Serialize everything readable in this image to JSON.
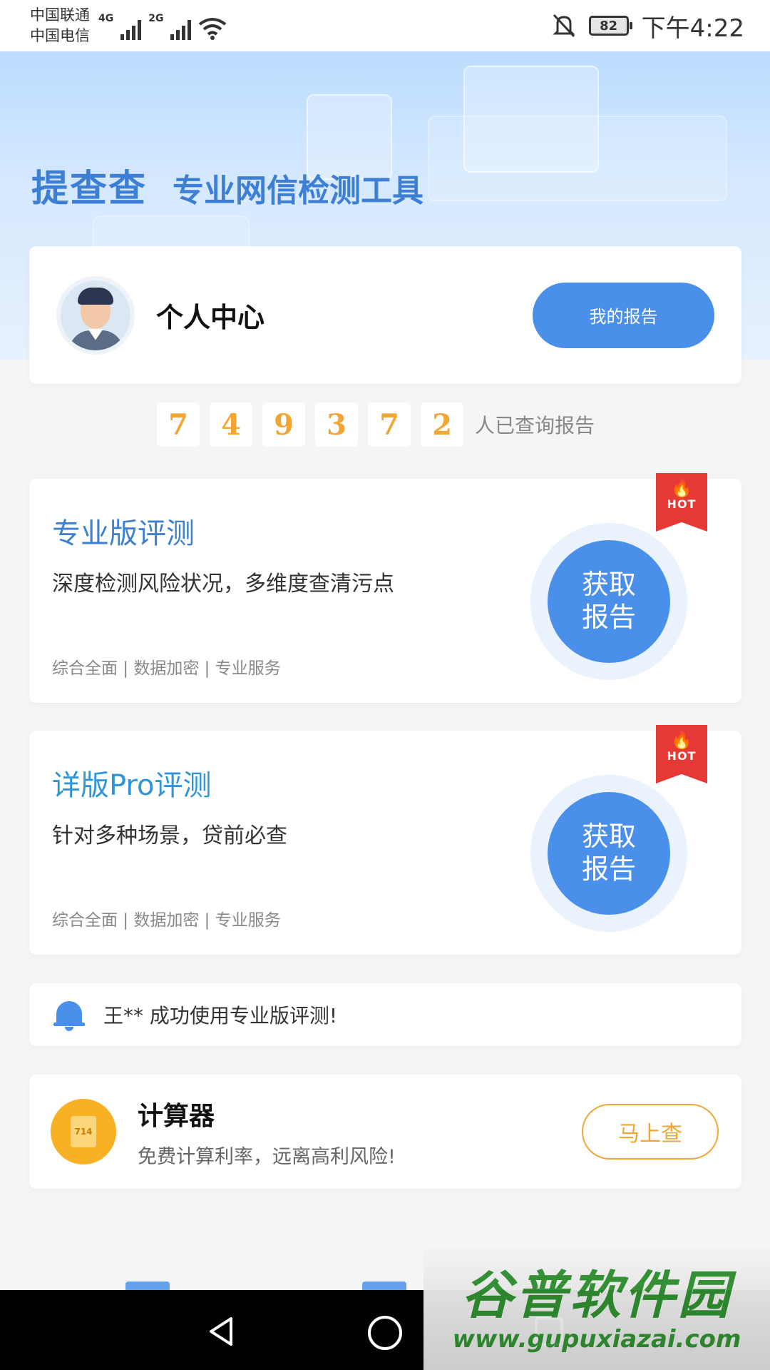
{
  "status_bar": {
    "carrier_1": "中国联通",
    "carrier_2": "中国电信",
    "net_1": "4G",
    "net_2": "2G",
    "battery": "82",
    "time": "下午4:22"
  },
  "banner": {
    "brand": "提查查",
    "slogan": "专业网信检测工具"
  },
  "profile": {
    "title": "个人中心",
    "report_button": "我的报告"
  },
  "counter": {
    "digits": [
      "7",
      "4",
      "9",
      "3",
      "7",
      "2"
    ],
    "label": "人已查询报告"
  },
  "products": [
    {
      "title": "专业版评测",
      "desc": "深度检测风险状况，多维度查清污点",
      "tags": "综合全面 | 数据加密 | 专业服务",
      "button": "获取报告",
      "badge": "HOT"
    },
    {
      "title": "详版Pro评测",
      "desc": "针对多种场景，贷前必查",
      "tags": "综合全面 | 数据加密 | 专业服务",
      "button": "获取报告",
      "badge": "HOT"
    }
  ],
  "notice": {
    "text": "王** 成功使用专业版评测!"
  },
  "calculator": {
    "icon_text": "714",
    "title": "计算器",
    "subtitle": "免费计算利率，远离高利风险!",
    "button": "马上查"
  },
  "watermark": {
    "title": "谷普软件园",
    "url": "www.gupuxiazai.com"
  },
  "colors": {
    "primary": "#4a90ea",
    "accent": "#f3a533",
    "hot": "#e53935"
  }
}
